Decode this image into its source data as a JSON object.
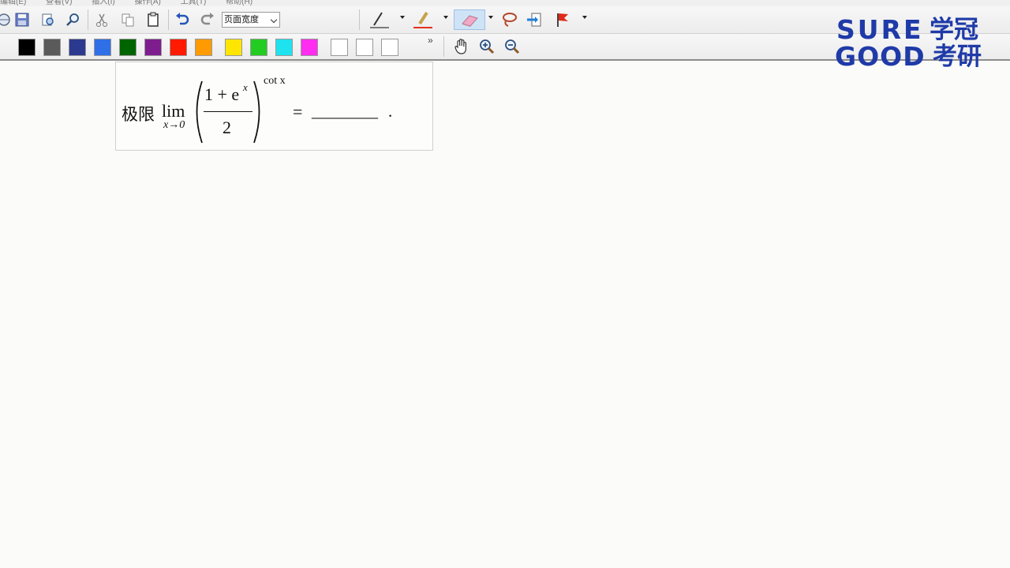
{
  "menu": {
    "items": [
      "编辑(E)",
      "查看(V)",
      "插入(I)",
      "操作(A)",
      "工具(T)",
      "帮助(H)"
    ]
  },
  "toolbar": {
    "zoom_value": "页面宽度",
    "more_glyph": "»"
  },
  "colors": {
    "palette": [
      "#000000",
      "#5a5a5a",
      "#2b3a8f",
      "#2f6fe8",
      "#006400",
      "#7e1d8e",
      "#ff1a00",
      "#ff9a00",
      "#ffe600",
      "#22cc22",
      "#1ee3ef",
      "#ff2df0",
      "#ffffff",
      "#ffffff",
      "#ffffff"
    ],
    "accent_brand": "#1f3aa8"
  },
  "logo": {
    "line1": "SURE",
    "line2": "GOOD",
    "cn1": "学冠",
    "cn2": "考研"
  },
  "formula": {
    "prefix": "极限",
    "lim": "lim",
    "lim_sub": "x→0",
    "numerator": "1 + e",
    "numerator_exp": "x",
    "denominator": "2",
    "exponent": "cot x",
    "equals": "=",
    "blank": "________",
    "period": "."
  }
}
